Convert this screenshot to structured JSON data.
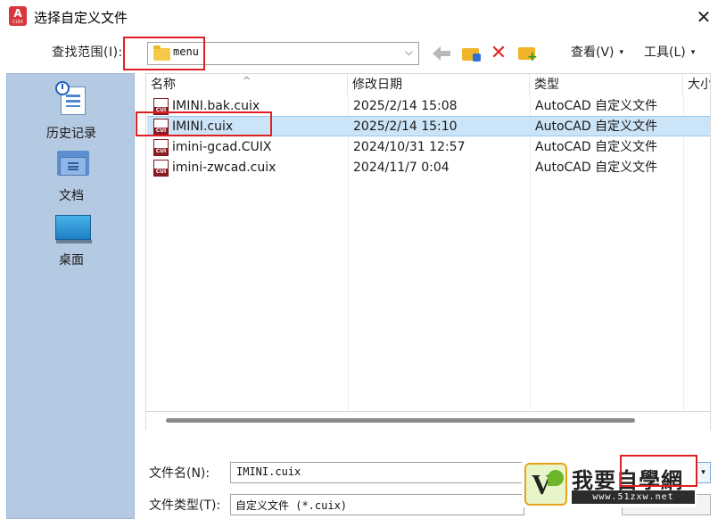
{
  "window": {
    "title": "选择自定义文件",
    "app_icon_letter": "A",
    "app_icon_sub": "CUIX",
    "close_glyph": "✕"
  },
  "toolbar": {
    "look_in_label": "查找范围(I):",
    "look_in_value": "menu",
    "combo_arrow": "⌵",
    "delete_glyph": "✕",
    "new_folder_plus": "+",
    "view_menu": "查看(V)",
    "tools_menu": "工具(L)",
    "menu_caret": "▾"
  },
  "places": [
    {
      "label": "历史记录",
      "icon": "history-icon"
    },
    {
      "label": "文档",
      "icon": "documents-icon"
    },
    {
      "label": "桌面",
      "icon": "desktop-icon"
    }
  ],
  "file_list": {
    "sort_indicator": "^",
    "columns": [
      "名称",
      "修改日期",
      "类型",
      "大小"
    ],
    "icon_label": "CUI",
    "rows": [
      {
        "name": "IMINI.bak.cuix",
        "modified": "2025/2/14 15:08",
        "type": "AutoCAD 自定义文件",
        "selected": false
      },
      {
        "name": "IMINI.cuix",
        "modified": "2025/2/14 15:10",
        "type": "AutoCAD 自定义文件",
        "selected": true
      },
      {
        "name": "imini-gcad.CUIX",
        "modified": "2024/10/31 12:57",
        "type": "AutoCAD 自定义文件",
        "selected": false
      },
      {
        "name": "imini-zwcad.cuix",
        "modified": "2024/11/7 0:04",
        "type": "AutoCAD 自定义文件",
        "selected": false
      }
    ]
  },
  "bottom": {
    "filename_label": "文件名(N):",
    "filename_value": "IMINI.cuix",
    "filetype_label": "文件类型(T):",
    "filetype_value": "自定义文件 (*.cuix)",
    "open_dropdown": "▾"
  },
  "watermark": {
    "text": "我要自學網",
    "url": "www.51zxw.net"
  },
  "colors": {
    "highlight_border": "#e02020",
    "selection": "#cce4f7",
    "places_bg": "#b4c9e2"
  }
}
